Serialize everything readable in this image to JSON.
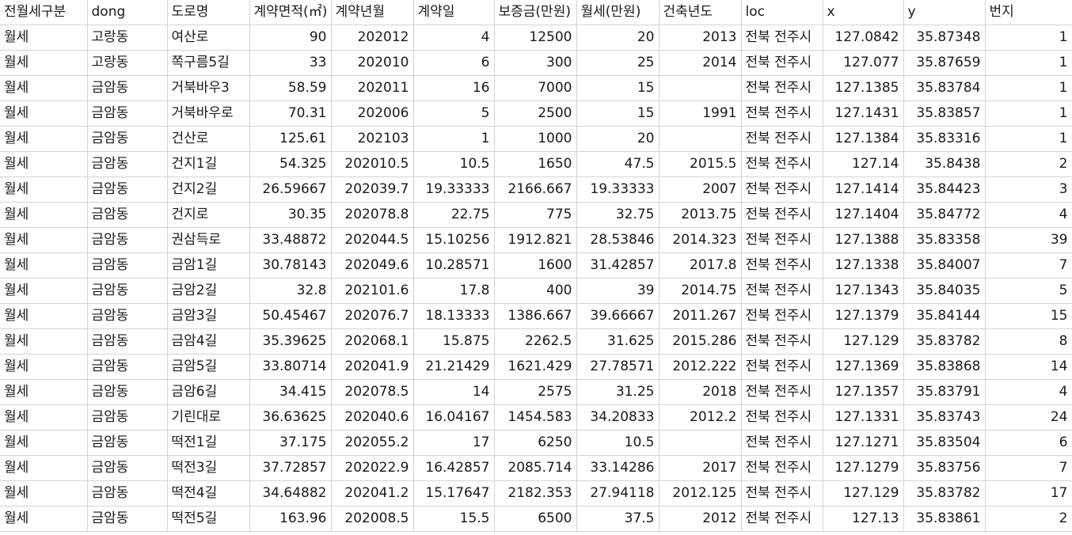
{
  "columns": [
    "전월세구분",
    "dong",
    "도로명",
    "계약면적(㎡)",
    "계약년월",
    "계약일",
    "보증금(만원)",
    "월세(만원)",
    "건축년도",
    "loc",
    "x",
    "y",
    "번지"
  ],
  "rows": [
    [
      "월세",
      "고랑동",
      "여산로",
      "90",
      "202012",
      "4",
      "12500",
      "20",
      "2013",
      "전북 전주시",
      "127.0842",
      "35.87348",
      "1"
    ],
    [
      "월세",
      "고랑동",
      "쪽구름5길",
      "33",
      "202010",
      "6",
      "300",
      "25",
      "2014",
      "전북 전주시",
      "127.077",
      "35.87659",
      "1"
    ],
    [
      "월세",
      "금암동",
      "거북바우3",
      "58.59",
      "202011",
      "16",
      "7000",
      "15",
      "",
      "전북 전주시",
      "127.1385",
      "35.83784",
      "1"
    ],
    [
      "월세",
      "금암동",
      "거북바우로",
      "70.31",
      "202006",
      "5",
      "2500",
      "15",
      "1991",
      "전북 전주시",
      "127.1431",
      "35.83857",
      "1"
    ],
    [
      "월세",
      "금암동",
      "건산로",
      "125.61",
      "202103",
      "1",
      "1000",
      "20",
      "",
      "전북 전주시",
      "127.1384",
      "35.83316",
      "1"
    ],
    [
      "월세",
      "금암동",
      "건지1길",
      "54.325",
      "202010.5",
      "10.5",
      "1650",
      "47.5",
      "2015.5",
      "전북 전주시",
      "127.14",
      "35.8438",
      "2"
    ],
    [
      "월세",
      "금암동",
      "건지2길",
      "26.59667",
      "202039.7",
      "19.33333",
      "2166.667",
      "19.33333",
      "2007",
      "전북 전주시",
      "127.1414",
      "35.84423",
      "3"
    ],
    [
      "월세",
      "금암동",
      "건지로",
      "30.35",
      "202078.8",
      "22.75",
      "775",
      "32.75",
      "2013.75",
      "전북 전주시",
      "127.1404",
      "35.84772",
      "4"
    ],
    [
      "월세",
      "금암동",
      "권삼득로",
      "33.48872",
      "202044.5",
      "15.10256",
      "1912.821",
      "28.53846",
      "2014.323",
      "전북 전주시",
      "127.1388",
      "35.83358",
      "39"
    ],
    [
      "월세",
      "금암동",
      "금암1길",
      "30.78143",
      "202049.6",
      "10.28571",
      "1600",
      "31.42857",
      "2017.8",
      "전북 전주시",
      "127.1338",
      "35.84007",
      "7"
    ],
    [
      "월세",
      "금암동",
      "금암2길",
      "32.8",
      "202101.6",
      "17.8",
      "400",
      "39",
      "2014.75",
      "전북 전주시",
      "127.1343",
      "35.84035",
      "5"
    ],
    [
      "월세",
      "금암동",
      "금암3길",
      "50.45467",
      "202076.7",
      "18.13333",
      "1386.667",
      "39.66667",
      "2011.267",
      "전북 전주시",
      "127.1379",
      "35.84144",
      "15"
    ],
    [
      "월세",
      "금암동",
      "금암4길",
      "35.39625",
      "202068.1",
      "15.875",
      "2262.5",
      "31.625",
      "2015.286",
      "전북 전주시",
      "127.129",
      "35.83782",
      "8"
    ],
    [
      "월세",
      "금암동",
      "금암5길",
      "33.80714",
      "202041.9",
      "21.21429",
      "1621.429",
      "27.78571",
      "2012.222",
      "전북 전주시",
      "127.1369",
      "35.83868",
      "14"
    ],
    [
      "월세",
      "금암동",
      "금암6길",
      "34.415",
      "202078.5",
      "14",
      "2575",
      "31.25",
      "2018",
      "전북 전주시",
      "127.1357",
      "35.83791",
      "4"
    ],
    [
      "월세",
      "금암동",
      "기린대로",
      "36.63625",
      "202040.6",
      "16.04167",
      "1454.583",
      "34.20833",
      "2012.2",
      "전북 전주시",
      "127.1331",
      "35.83743",
      "24"
    ],
    [
      "월세",
      "금암동",
      "떡전1길",
      "37.175",
      "202055.2",
      "17",
      "6250",
      "10.5",
      "",
      "전북 전주시",
      "127.1271",
      "35.83504",
      "6"
    ],
    [
      "월세",
      "금암동",
      "떡전3길",
      "37.72857",
      "202022.9",
      "16.42857",
      "2085.714",
      "33.14286",
      "2017",
      "전북 전주시",
      "127.1279",
      "35.83756",
      "7"
    ],
    [
      "월세",
      "금암동",
      "떡전4길",
      "34.64882",
      "202041.2",
      "15.17647",
      "2182.353",
      "27.94118",
      "2012.125",
      "전북 전주시",
      "127.129",
      "35.83782",
      "17"
    ],
    [
      "월세",
      "금암동",
      "떡전5길",
      "163.96",
      "202008.5",
      "15.5",
      "6500",
      "37.5",
      "2012",
      "전북 전주시",
      "127.13",
      "35.83861",
      "2"
    ]
  ],
  "column_kinds": [
    "txt",
    "txt",
    "txt",
    "num",
    "num",
    "num",
    "num",
    "num",
    "num",
    "loc",
    "num",
    "num",
    "num"
  ],
  "colors": {
    "grid_line": "#d4d4d4",
    "text": "#1a1a1a",
    "background": "#ffffff"
  }
}
